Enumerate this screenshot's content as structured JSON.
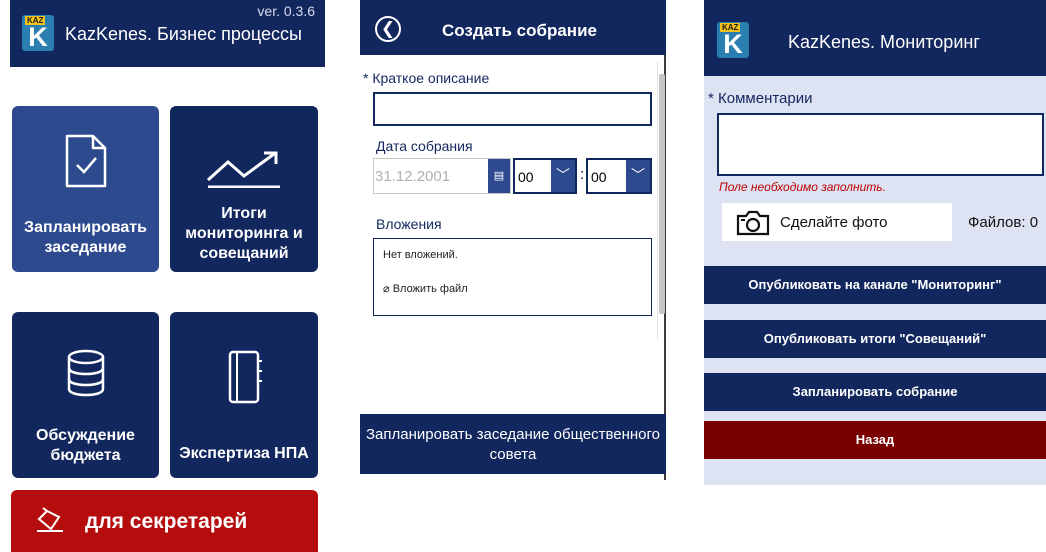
{
  "business": {
    "version": "ver. 0.3.6",
    "logo_badge": "KAZ",
    "logo_letter": "K",
    "title": "KazKenes. Бизнес процессы",
    "tiles": {
      "plan": "Запланировать заседание",
      "results": "Итоги мониторинга и совещаний",
      "budget": "Обсуждение бюджета",
      "expert": "Экспертиза НПА"
    },
    "secretary_label": "для секретарей"
  },
  "meeting": {
    "title": "Создать собрание",
    "short_desc_label": "Краткое описание",
    "required_mark": "*",
    "date_label": "Дата собрания",
    "date_placeholder": "31.12.2001",
    "hour": "00",
    "minute": "00",
    "time_separator": ":",
    "attachments_label": "Вложения",
    "no_attachments": "Нет вложений.",
    "attach_file": "Вложить файл",
    "submit": "Запланировать заседание общественного совета"
  },
  "monitoring": {
    "logo_badge": "KAZ",
    "logo_letter": "K",
    "title": "KazKenes. Мониторинг",
    "required_mark": "*",
    "comment_label": "Комментарии",
    "error": "Поле необходимо заполнить.",
    "photo_button": "Сделайте фото",
    "files_count": "Файлов: 0",
    "buttons": {
      "publish_monitoring": "Опубликовать на канале \"Мониторинг\"",
      "publish_meetings": "Опубликовать итоги \"Совещаний\"",
      "schedule": "Запланировать собрание",
      "back": "Назад"
    }
  },
  "colors": {
    "navy": "#13275f",
    "tile_highlight": "#2e4a8f",
    "red": "#b50d0d",
    "dark_red": "#7a0000",
    "panel_bg": "#dde3f2"
  }
}
